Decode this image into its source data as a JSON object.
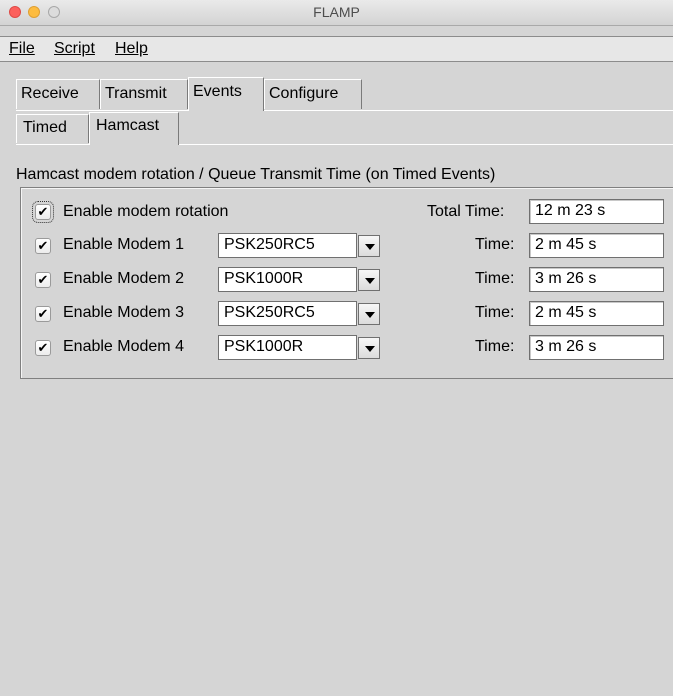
{
  "window": {
    "title": "FLAMP"
  },
  "menu": {
    "file": "File",
    "script": "Script",
    "help": "Help"
  },
  "tabs": [
    "Receive",
    "Transmit",
    "Events",
    "Configure"
  ],
  "selected_tab": "Events",
  "subtabs": [
    "Timed",
    "Hamcast"
  ],
  "selected_subtab": "Hamcast",
  "hamcast": {
    "group_label": "Hamcast modem rotation / Queue Transmit Time (on Timed Events)",
    "rotation": {
      "label": "Enable modem rotation",
      "checked": true
    },
    "total_time_label": "Total Time:",
    "total_time": "12 m 23 s",
    "time_label": "Time:",
    "modems": [
      {
        "label": "Enable Modem 1",
        "checked": true,
        "mode": "PSK250RC5",
        "time": "2 m 45 s"
      },
      {
        "label": "Enable Modem 2",
        "checked": true,
        "mode": "PSK1000R",
        "time": "3 m 26 s"
      },
      {
        "label": "Enable Modem 3",
        "checked": true,
        "mode": "PSK250RC5",
        "time": "2 m 45 s"
      },
      {
        "label": "Enable Modem 4",
        "checked": true,
        "mode": "PSK1000R",
        "time": "3 m 26 s"
      }
    ]
  },
  "icons": {
    "close": "close-button-icon",
    "minimize": "minimize-button-icon",
    "zoom": "zoom-button-icon",
    "checkmark": "✔",
    "dropdown": "chevron-down-icon"
  },
  "colors": {
    "close": "#fc605c",
    "minimize": "#fdbc40",
    "zoom": "#dcdcdc",
    "window_bg": "#d5d5d5",
    "field_bg": "#ffffff"
  }
}
